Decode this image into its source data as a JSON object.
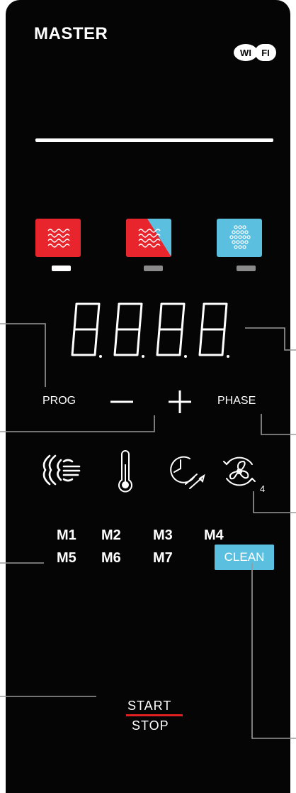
{
  "panel": {
    "title": "MASTER",
    "wifi_label": "WI FI",
    "colors": {
      "background": "#050505",
      "red": "#e8242c",
      "blue": "#5bc0e0",
      "led_on": "#ffffff",
      "led_off": "#8a8a8a",
      "callout_line": "#9a9a9a"
    }
  },
  "modes": [
    {
      "name": "convection",
      "icon": "convection-heat-icon",
      "led": "on"
    },
    {
      "name": "combi",
      "icon": "combi-mode-icon",
      "led": "off"
    },
    {
      "name": "steam",
      "icon": "steam-mode-icon",
      "led": "off"
    }
  ],
  "display": {
    "digits": [
      "8.",
      "8.",
      "8.",
      "8."
    ]
  },
  "controls": {
    "prog_label": "PROG",
    "minus_label": "—",
    "plus_label": "+",
    "phase_label": "PHASE"
  },
  "parameters": [
    {
      "name": "humidity",
      "icon": "humidity-icon"
    },
    {
      "name": "temperature",
      "icon": "thermometer-icon"
    },
    {
      "name": "time-probe",
      "icon": "clock-probe-icon"
    },
    {
      "name": "fan-speed",
      "icon": "fan-icon",
      "value": "4"
    }
  ],
  "memories": {
    "row1": [
      "M1",
      "M2",
      "M3",
      "M4"
    ],
    "row2": [
      "M5",
      "M6",
      "M7"
    ],
    "clean_label": "CLEAN"
  },
  "start_stop": {
    "start_label": "START",
    "stop_label": "STOP"
  }
}
